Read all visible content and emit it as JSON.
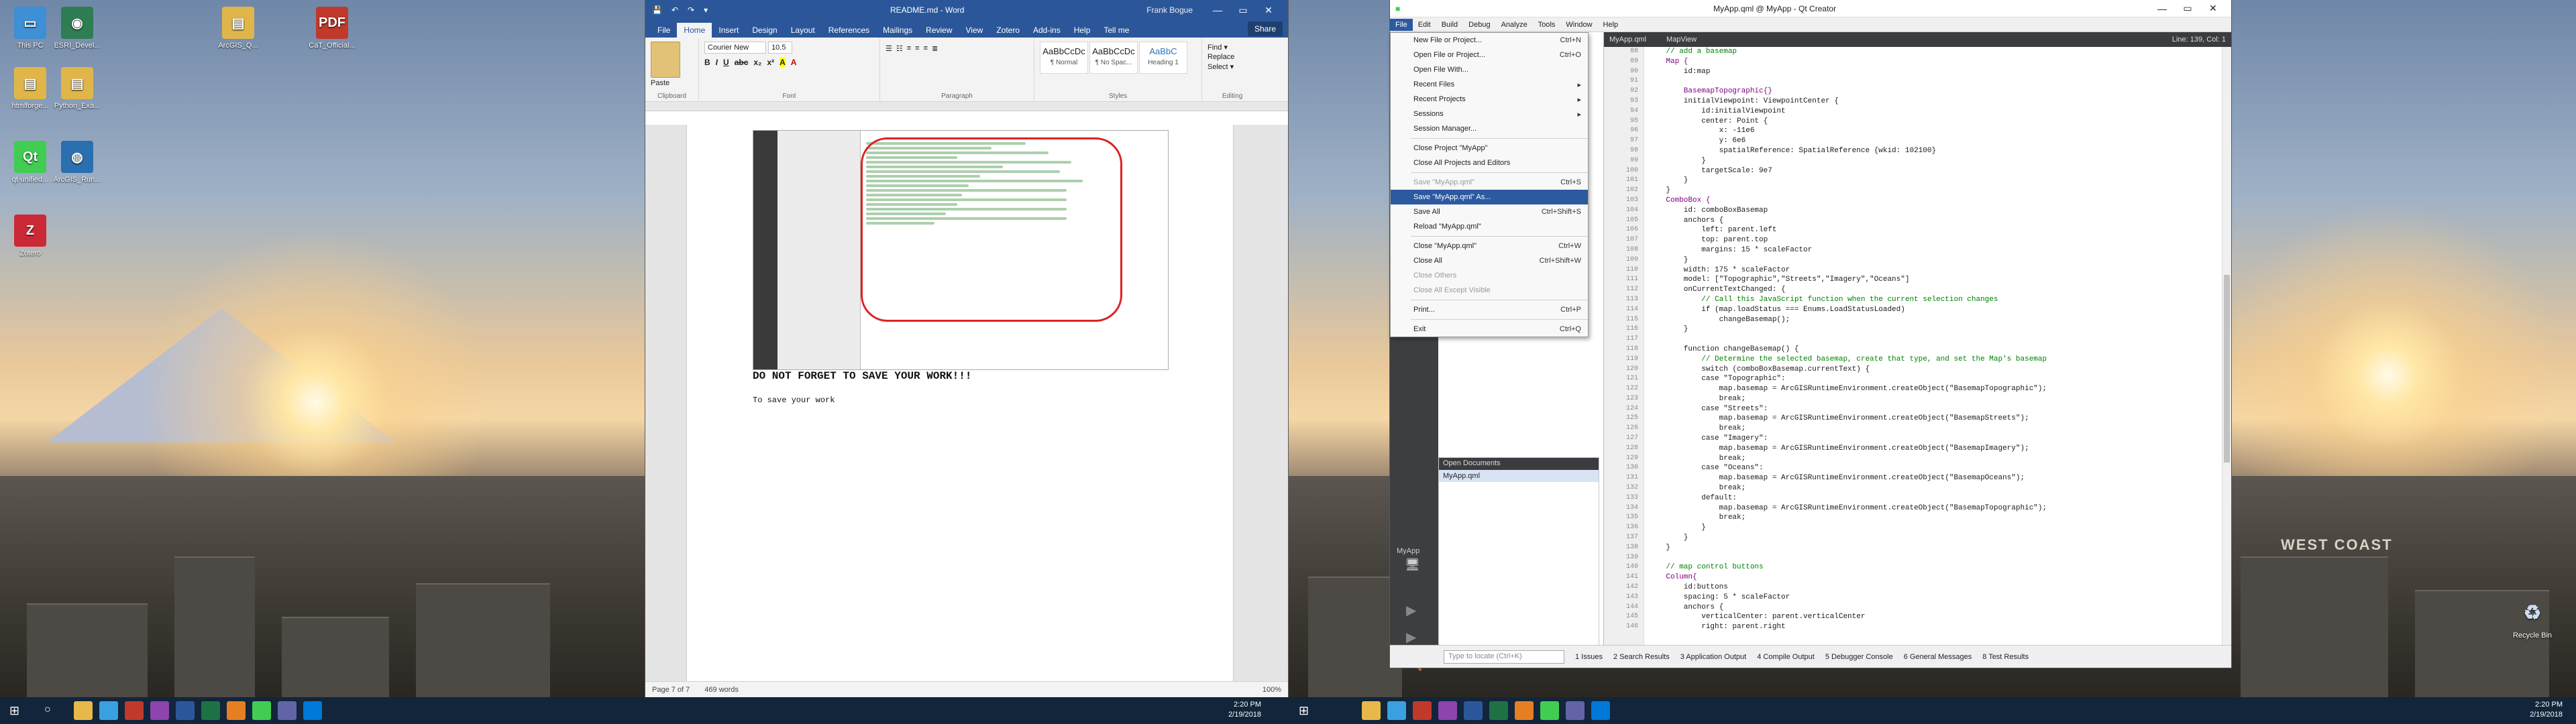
{
  "desktop": {
    "icons": [
      {
        "label": "This PC",
        "color": "#3d8fd6",
        "glyph": "▭"
      },
      {
        "label": "ESRI_Devel...",
        "color": "#2f7d52",
        "glyph": "◉"
      },
      {
        "label": "ArcGIS_Q...",
        "color": "#e0b64a",
        "glyph": "▤"
      },
      {
        "label": "CaT_Official...",
        "color": "#c0392b",
        "glyph": "PDF"
      },
      {
        "label": "htmlforge...",
        "color": "#e0b64a",
        "glyph": "▤"
      },
      {
        "label": "Python_Exa...",
        "color": "#e0b64a",
        "glyph": "▤"
      },
      {
        "label": "qt-unified...",
        "color": "#41cd52",
        "glyph": "Qt"
      },
      {
        "label": "ArcGIS_Run...",
        "color": "#2a6fb0",
        "glyph": "◍"
      },
      {
        "label": "Zotero",
        "color": "#cc2936",
        "glyph": "Z"
      }
    ],
    "right_icons": [
      {
        "label": "Recycle Bin",
        "glyph": "♻"
      }
    ],
    "wall_text": "WEST COAST"
  },
  "word": {
    "qat": [
      "💾",
      "↶",
      "↷",
      "▾"
    ],
    "title": "README.md - Word",
    "user": "Frank Bogue",
    "window_buttons": [
      "—",
      "▭",
      "✕"
    ],
    "tabs": [
      "File",
      "Home",
      "Insert",
      "Design",
      "Layout",
      "References",
      "Mailings",
      "Review",
      "View",
      "Zotero",
      "Add-ins",
      "Help",
      "Tell me"
    ],
    "share": "Share",
    "ribbon": {
      "clipboard": {
        "paste": "Paste",
        "group": "Clipboard"
      },
      "font": {
        "name": "Courier New",
        "size": "10.5",
        "group": "Font",
        "buttons": [
          "B",
          "I",
          "U",
          "abc",
          "x₂",
          "x²",
          "A",
          "A"
        ]
      },
      "paragraph": {
        "group": "Paragraph"
      },
      "styles": {
        "group": "Styles",
        "items": [
          {
            "preview": "AaBbCcDc",
            "name": "¶ Normal"
          },
          {
            "preview": "AaBbCcDc",
            "name": "¶ No Spac..."
          },
          {
            "preview": "AaBbC",
            "name": "Heading 1"
          }
        ]
      },
      "editing": {
        "group": "Editing",
        "items": [
          "Find ▾",
          "Replace",
          "Select ▾"
        ]
      }
    },
    "heading": "DO NOT FORGET TO SAVE YOUR WORK!!!",
    "body": "To save your work",
    "status": {
      "page": "Page 7 of 7",
      "words": "469 words",
      "zoom": "100%"
    }
  },
  "qt": {
    "title": "MyApp.qml @ MyApp - Qt Creator",
    "window_buttons": [
      "—",
      "▭",
      "✕"
    ],
    "menu": [
      "File",
      "Edit",
      "Build",
      "Debug",
      "Analyze",
      "Tools",
      "Window",
      "Help"
    ],
    "modes": [
      {
        "label": "MyApp",
        "glyph": "🖥"
      }
    ],
    "file_menu": [
      {
        "label": "New File or Project...",
        "key": "Ctrl+N",
        "state": "normal"
      },
      {
        "label": "Open File or Project...",
        "key": "Ctrl+O",
        "state": "normal"
      },
      {
        "label": "Open File With...",
        "key": "",
        "state": "normal"
      },
      {
        "label": "Recent Files",
        "key": "▸",
        "state": "normal"
      },
      {
        "label": "Recent Projects",
        "key": "▸",
        "state": "normal"
      },
      {
        "label": "Sessions",
        "key": "▸",
        "state": "normal"
      },
      {
        "label": "Session Manager...",
        "key": "",
        "state": "normal"
      },
      {
        "sep": true
      },
      {
        "label": "Close Project \"MyApp\"",
        "key": "",
        "state": "normal"
      },
      {
        "label": "Close All Projects and Editors",
        "key": "",
        "state": "normal"
      },
      {
        "sep": true
      },
      {
        "label": "Save \"MyApp.qml\"",
        "key": "Ctrl+S",
        "state": "disabled"
      },
      {
        "label": "Save \"MyApp.qml\" As...",
        "key": "",
        "state": "highlight"
      },
      {
        "label": "Save All",
        "key": "Ctrl+Shift+S",
        "state": "normal"
      },
      {
        "label": "Reload \"MyApp.qml\"",
        "key": "",
        "state": "normal"
      },
      {
        "sep": true
      },
      {
        "label": "Close \"MyApp.qml\"",
        "key": "Ctrl+W",
        "state": "normal"
      },
      {
        "label": "Close All",
        "key": "Ctrl+Shift+W",
        "state": "normal"
      },
      {
        "label": "Close Others",
        "key": "",
        "state": "disabled"
      },
      {
        "label": "Close All Except Visible",
        "key": "",
        "state": "disabled"
      },
      {
        "sep": true
      },
      {
        "label": "Print...",
        "key": "Ctrl+P",
        "state": "normal"
      },
      {
        "sep": true
      },
      {
        "label": "Exit",
        "key": "Ctrl+Q",
        "state": "normal"
      }
    ],
    "open_documents": {
      "title": "Open Documents",
      "items": [
        "MyApp.qml"
      ]
    },
    "editor_tabs": {
      "file": "MyApp.qml",
      "symbol": "MapView",
      "position": "Line: 139, Col: 1"
    },
    "code_start_line": 88,
    "code": [
      "    // add a basemap",
      "    Map {",
      "        id:map",
      "",
      "        BasemapTopographic{}",
      "        initialViewpoint: ViewpointCenter {",
      "            id:initialViewpoint",
      "            center: Point {",
      "                x: -11e6",
      "                y: 6e6",
      "                spatialReference: SpatialReference {wkid: 102100}",
      "            }",
      "            targetScale: 9e7",
      "        }",
      "    }",
      "    ComboBox {",
      "        id: comboBoxBasemap",
      "        anchors {",
      "            left: parent.left",
      "            top: parent.top",
      "            margins: 15 * scaleFactor",
      "        }",
      "        width: 175 * scaleFactor",
      "        model: [\"Topographic\",\"Streets\",\"Imagery\",\"Oceans\"]",
      "        onCurrentTextChanged: {",
      "            // Call this JavaScript function when the current selection changes",
      "            if (map.loadStatus === Enums.LoadStatusLoaded)",
      "                changeBasemap();",
      "        }",
      "",
      "        function changeBasemap() {",
      "            // Determine the selected basemap, create that type, and set the Map's basemap",
      "            switch (comboBoxBasemap.currentText) {",
      "            case \"Topographic\":",
      "                map.basemap = ArcGISRuntimeEnvironment.createObject(\"BasemapTopographic\");",
      "                break;",
      "            case \"Streets\":",
      "                map.basemap = ArcGISRuntimeEnvironment.createObject(\"BasemapStreets\");",
      "                break;",
      "            case \"Imagery\":",
      "                map.basemap = ArcGISRuntimeEnvironment.createObject(\"BasemapImagery\");",
      "                break;",
      "            case \"Oceans\":",
      "                map.basemap = ArcGISRuntimeEnvironment.createObject(\"BasemapOceans\");",
      "                break;",
      "            default:",
      "                map.basemap = ArcGISRuntimeEnvironment.createObject(\"BasemapTopographic\");",
      "                break;",
      "            }",
      "        }",
      "    }",
      "",
      "    // map control buttons",
      "    Column{",
      "        id:buttons",
      "        spacing: 5 * scaleFactor",
      "        anchors {",
      "            verticalCenter: parent.verticalCenter",
      "            right: parent.right"
    ],
    "locate_placeholder": "Type to locate (Ctrl+K)",
    "output_panes": [
      "1 Issues",
      "2 Search Results",
      "3 Application Output",
      "4 Compile Output",
      "5 Debugger Console",
      "6 General Messages",
      "8 Test Results"
    ]
  },
  "taskbar": {
    "left_clock": {
      "time": "2:20 PM",
      "date": "2/19/2018"
    },
    "right_clock": {
      "time": "2:20 PM",
      "date": "2/19/2018"
    },
    "apps": [
      "#e8b84a",
      "#3aa0e0",
      "#c0392b",
      "#8e44ad",
      "#2b579a",
      "#1e7145",
      "#e67e22",
      "#41cd52",
      "#6264a7",
      "#0078d7"
    ]
  },
  "colors": {
    "word_blue": "#2b579a",
    "qt_highlight": "#2c5aa0",
    "taskbar": "#12253a"
  }
}
